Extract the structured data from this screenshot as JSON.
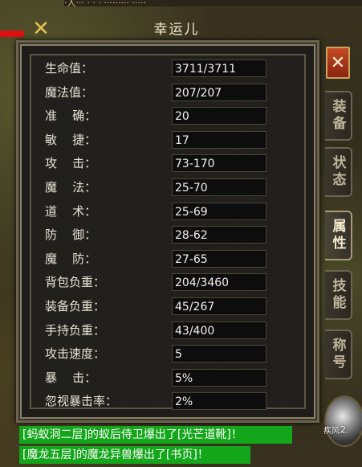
{
  "top_strip": "·人··· · · · ········· ·····",
  "panel": {
    "title": "幸运儿"
  },
  "stats": [
    {
      "label": "生命值：",
      "value": "3711/3711"
    },
    {
      "label": "魔法值：",
      "value": "207/207"
    },
    {
      "label": "准    确：",
      "value": "20"
    },
    {
      "label": "敏    捷：",
      "value": "17"
    },
    {
      "label": "攻    击：",
      "value": "73-170"
    },
    {
      "label": "魔    法：",
      "value": "25-70"
    },
    {
      "label": "道    术：",
      "value": "25-69"
    },
    {
      "label": "防    御：",
      "value": "28-62"
    },
    {
      "label": "魔    防：",
      "value": "27-65"
    },
    {
      "label": "背包负重：",
      "value": "204/3460"
    },
    {
      "label": "装备负重：",
      "value": "45/267"
    },
    {
      "label": "手持负重：",
      "value": "43/400"
    },
    {
      "label": "攻击速度：",
      "value": "5"
    },
    {
      "label": "暴    击：",
      "value": "5%"
    },
    {
      "label": "忽视暴击率：",
      "value": "2%"
    }
  ],
  "tabs": [
    {
      "label": "装备"
    },
    {
      "label": "状态"
    },
    {
      "label": "属性"
    },
    {
      "label": "技能"
    },
    {
      "label": "称号"
    }
  ],
  "close_label": "✕",
  "corner_close_label": "✕",
  "skill": {
    "label": "疾风…",
    "count": "2"
  },
  "chat": [
    "[蚂蚁洞二层]的蚁后侍卫爆出了[光芒道靴]！",
    "[魔龙五层]的魔龙异兽爆出了[书页]！"
  ],
  "colors": {
    "chat_bg": "#13a51a",
    "close_btn": "#c44a24",
    "gold": "#e4c255"
  }
}
